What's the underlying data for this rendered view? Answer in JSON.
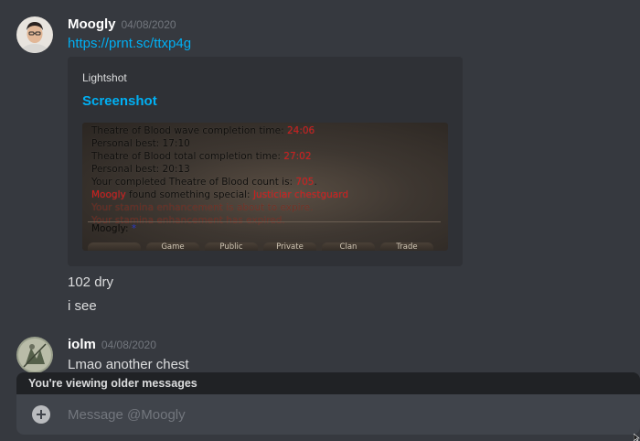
{
  "messages": [
    {
      "author": "Moogly",
      "timestamp": "04/08/2020",
      "avatar_icon": "avatar-icon",
      "lines": [
        "https://prnt.sc/ttxp4g",
        "102 dry",
        "i see"
      ],
      "embed": {
        "provider": "Lightshot",
        "title": "Screenshot",
        "game_chat": [
          {
            "text": "Theatre of Blood wave completion time: ",
            "value": "24:06"
          },
          {
            "text": "Personal best: 17:10",
            "value": ""
          },
          {
            "text": "Theatre of Blood total completion time: ",
            "value": "27:02"
          },
          {
            "text": "Personal best: 20:13",
            "value": ""
          },
          {
            "text": "Your completed Theatre of Blood count is: ",
            "value": "705",
            "suffix": "."
          },
          {
            "name": "Moogly",
            "text": " found something special: ",
            "value": "Justiciar chestguard"
          },
          {
            "text": "Your stamina enhancement is about to expire.",
            "faint": true
          },
          {
            "text": "Your stamina enhancement has expired.",
            "faint": true
          }
        ],
        "game_input": {
          "prefix": "Moogly: ",
          "star": "*"
        },
        "game_tabs": [
          "",
          "Game",
          "Public",
          "Private",
          "Clan",
          "Trade"
        ]
      }
    },
    {
      "author": "iolm",
      "timestamp": "04/08/2020",
      "avatar_icon": "avatar-icon",
      "lines": [
        "Lmao another chest"
      ]
    }
  ],
  "banner": {
    "text": "You're viewing older messages"
  },
  "composer": {
    "placeholder": "Message @Moogly",
    "add_icon": "plus-circle-icon"
  },
  "colors": {
    "background": "#36393f",
    "link": "#00b0f4",
    "embed_bg": "#2f3136",
    "input_bg": "#40444b",
    "banner_bg": "#202225",
    "game_red": "#d21a1a"
  }
}
